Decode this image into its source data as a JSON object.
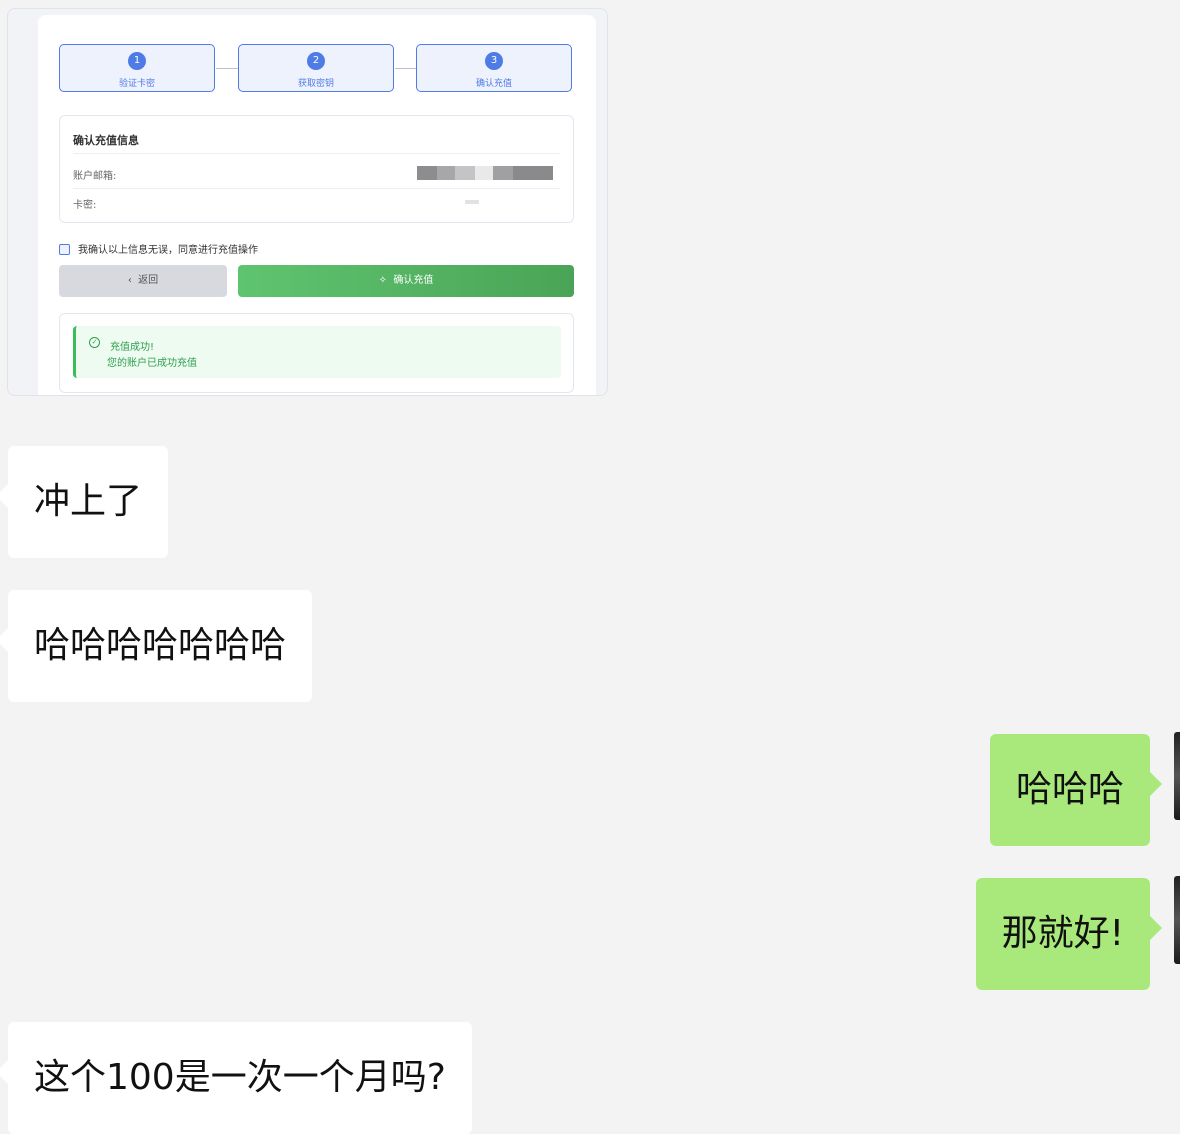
{
  "screenshot": {
    "steps": [
      {
        "num": "1",
        "label": "验证卡密"
      },
      {
        "num": "2",
        "label": "获取密钥"
      },
      {
        "num": "3",
        "label": "确认充值"
      }
    ],
    "info_title": "确认充值信息",
    "email_label": "账户邮箱:",
    "card_label": "卡密:",
    "confirm_check_label": "我确认以上信息无误，同意进行充值操作",
    "back_button": "返回",
    "confirm_button": "确认充值",
    "success_title": "充值成功!",
    "success_message": "您的账户已成功充值"
  },
  "messages": [
    {
      "side": "left",
      "text": "冲上了"
    },
    {
      "side": "left",
      "text": "哈哈哈哈哈哈哈"
    },
    {
      "side": "right",
      "text": "哈哈哈"
    },
    {
      "side": "right",
      "text": "那就好!"
    },
    {
      "side": "left",
      "text": "这个100是一次一个月吗?"
    }
  ],
  "colors": {
    "accent_blue": "#4f7be6",
    "confirm_green": "#4caf50",
    "success_green": "#3dbb5b",
    "bubble_self": "#a9e97b",
    "bubble_other": "#ffffff",
    "chat_background": "#f3f3f3"
  }
}
